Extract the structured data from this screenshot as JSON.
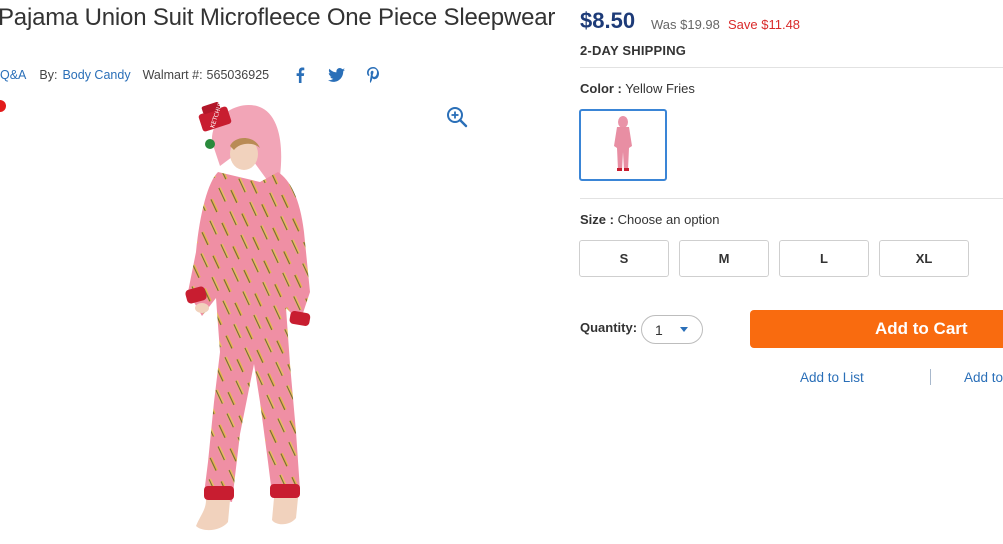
{
  "product": {
    "title": "Pajama Union Suit Microfleece One Piece Sleepwear",
    "qa_link": "Q&A",
    "by_label": "By:",
    "brand": "Body Candy",
    "walmart_label": "Walmart #:",
    "walmart_number": "565036925"
  },
  "social": {
    "facebook_icon": "facebook-icon",
    "twitter_icon": "twitter-icon",
    "pinterest_icon": "pinterest-icon"
  },
  "pricing": {
    "price": "$8.50",
    "was": "Was $19.98",
    "save": "Save $11.48",
    "shipping": "2-DAY SHIPPING"
  },
  "color": {
    "label": "Color :",
    "selected": "Yellow Fries"
  },
  "size": {
    "label": "Size :",
    "prompt": "Choose an option",
    "options": [
      "S",
      "M",
      "L",
      "XL"
    ]
  },
  "quantity": {
    "label": "Quantity:",
    "value": "1"
  },
  "actions": {
    "add_to_cart": "Add to Cart",
    "add_to_list": "Add to List",
    "add_to_registry": "Add to"
  },
  "image": {
    "hood_text": "KETCHUP"
  },
  "colors": {
    "link": "#2a6fb8",
    "price": "#1d3b78",
    "save": "#d92b2b",
    "cta": "#f96b0f"
  }
}
